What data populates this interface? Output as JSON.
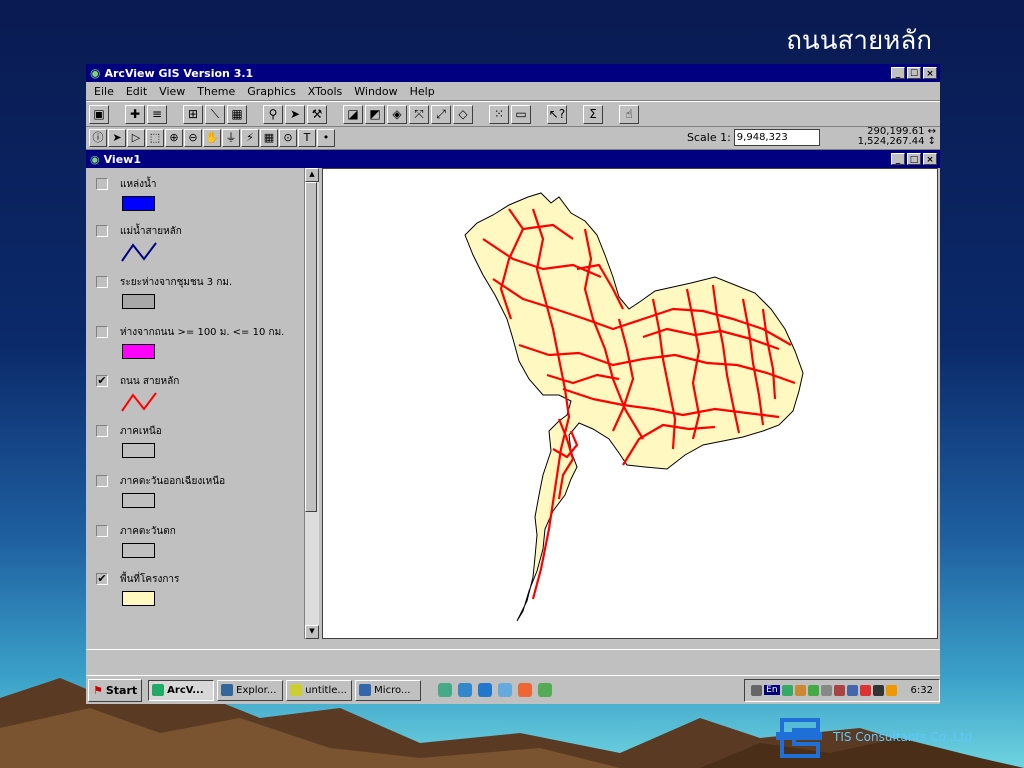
{
  "slide": {
    "title": "ถนนสายหลัก"
  },
  "app": {
    "title": "ArcView GIS Version 3.1",
    "window_buttons": [
      "_",
      "☐",
      "×"
    ],
    "menus": [
      {
        "label": "Eile"
      },
      {
        "label": "Edit"
      },
      {
        "label": "View"
      },
      {
        "label": "Theme"
      },
      {
        "label": "Graphics"
      },
      {
        "label": "XTools"
      },
      {
        "label": "Window"
      },
      {
        "label": "Help"
      }
    ],
    "scale_label": "Scale 1:",
    "scale_value": "9,948,323",
    "coord_x": "290,199.61",
    "coord_y": "1,524,267.44"
  },
  "view": {
    "title": "View1",
    "window_buttons": [
      "_",
      "□",
      "×"
    ]
  },
  "legend": [
    {
      "name": "แหล่งน้ำ",
      "checked": false,
      "symbol": "fill",
      "color": "#0000ff"
    },
    {
      "name": "แม่น้ำสายหลัก",
      "checked": false,
      "symbol": "line",
      "color": "#000080"
    },
    {
      "name": "ระยะห่างจากชุมชน 3 กม.",
      "checked": false,
      "symbol": "fill",
      "color": "#a8a8a8"
    },
    {
      "name": "ห่างจากถนน >= 100 ม. <= 10 กม.",
      "checked": false,
      "symbol": "fill",
      "color": "#ff00ff"
    },
    {
      "name": "ถนน สายหลัก",
      "checked": true,
      "symbol": "line",
      "color": "#ff0000"
    },
    {
      "name": "ภาคเหนือ",
      "checked": false,
      "symbol": "fill",
      "color": "#c0c0c0"
    },
    {
      "name": "ภาคตะวันออกเฉียงเหนือ",
      "checked": false,
      "symbol": "fill",
      "color": "#c0c0c0"
    },
    {
      "name": "ภาคตะวันตก",
      "checked": false,
      "symbol": "fill",
      "color": "#c0c0c0"
    },
    {
      "name": "พื้นที่โครงการ",
      "checked": true,
      "symbol": "fill",
      "color": "#fff8c0"
    }
  ],
  "taskbar": {
    "start": "Start",
    "tasks": [
      "ArcV...",
      "Explor...",
      "untitle...",
      "Micro..."
    ],
    "lang": "En",
    "clock": "6:32"
  },
  "company": {
    "name": "TIS Consultants Co.,Ltd."
  },
  "colors": {
    "road": "#ff0000",
    "land": "#fff8c0",
    "titlebar": "#000080"
  }
}
